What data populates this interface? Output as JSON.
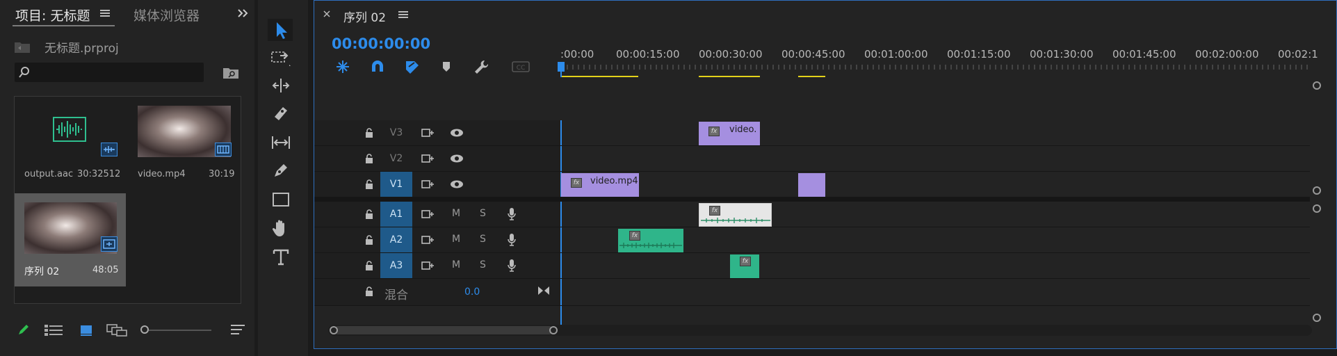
{
  "project_panel": {
    "tab_project": "项目: 无标题",
    "tab_media_browser": "媒体浏览器",
    "project_file": "无标题.prproj",
    "search_placeholder": "",
    "items": [
      {
        "name": "output.aac",
        "duration": "30:32512",
        "kind": "audio"
      },
      {
        "name": "video.mp4",
        "duration": "30:19",
        "kind": "video"
      },
      {
        "name": "序列 02",
        "duration": "48:05",
        "kind": "sequence"
      }
    ]
  },
  "timeline": {
    "tab_title": "序列 02",
    "timecode": "00:00:00:00",
    "ruler_labels": [
      ":00:00",
      "00:00:15:00",
      "00:00:30:00",
      "00:00:45:00",
      "00:01:00:00",
      "00:01:15:00",
      "00:01:30:00",
      "00:01:45:00",
      "00:02:00:00",
      "00:02:1"
    ],
    "tracks": {
      "V3": "V3",
      "V2": "V2",
      "V1": "V1",
      "A1": "A1",
      "A2": "A2",
      "A3": "A3"
    },
    "mute_label": "M",
    "solo_label": "S",
    "mix_label": "混合",
    "mix_value": "0.0",
    "clips": {
      "v3": "video.",
      "v1": "video.mp4"
    },
    "fx_label": "fx"
  },
  "colors": {
    "accent": "#2d8ceb",
    "video_clip": "#a58fe0",
    "audio_clip": "#2fb58a",
    "work_area": "#e3d21a"
  }
}
